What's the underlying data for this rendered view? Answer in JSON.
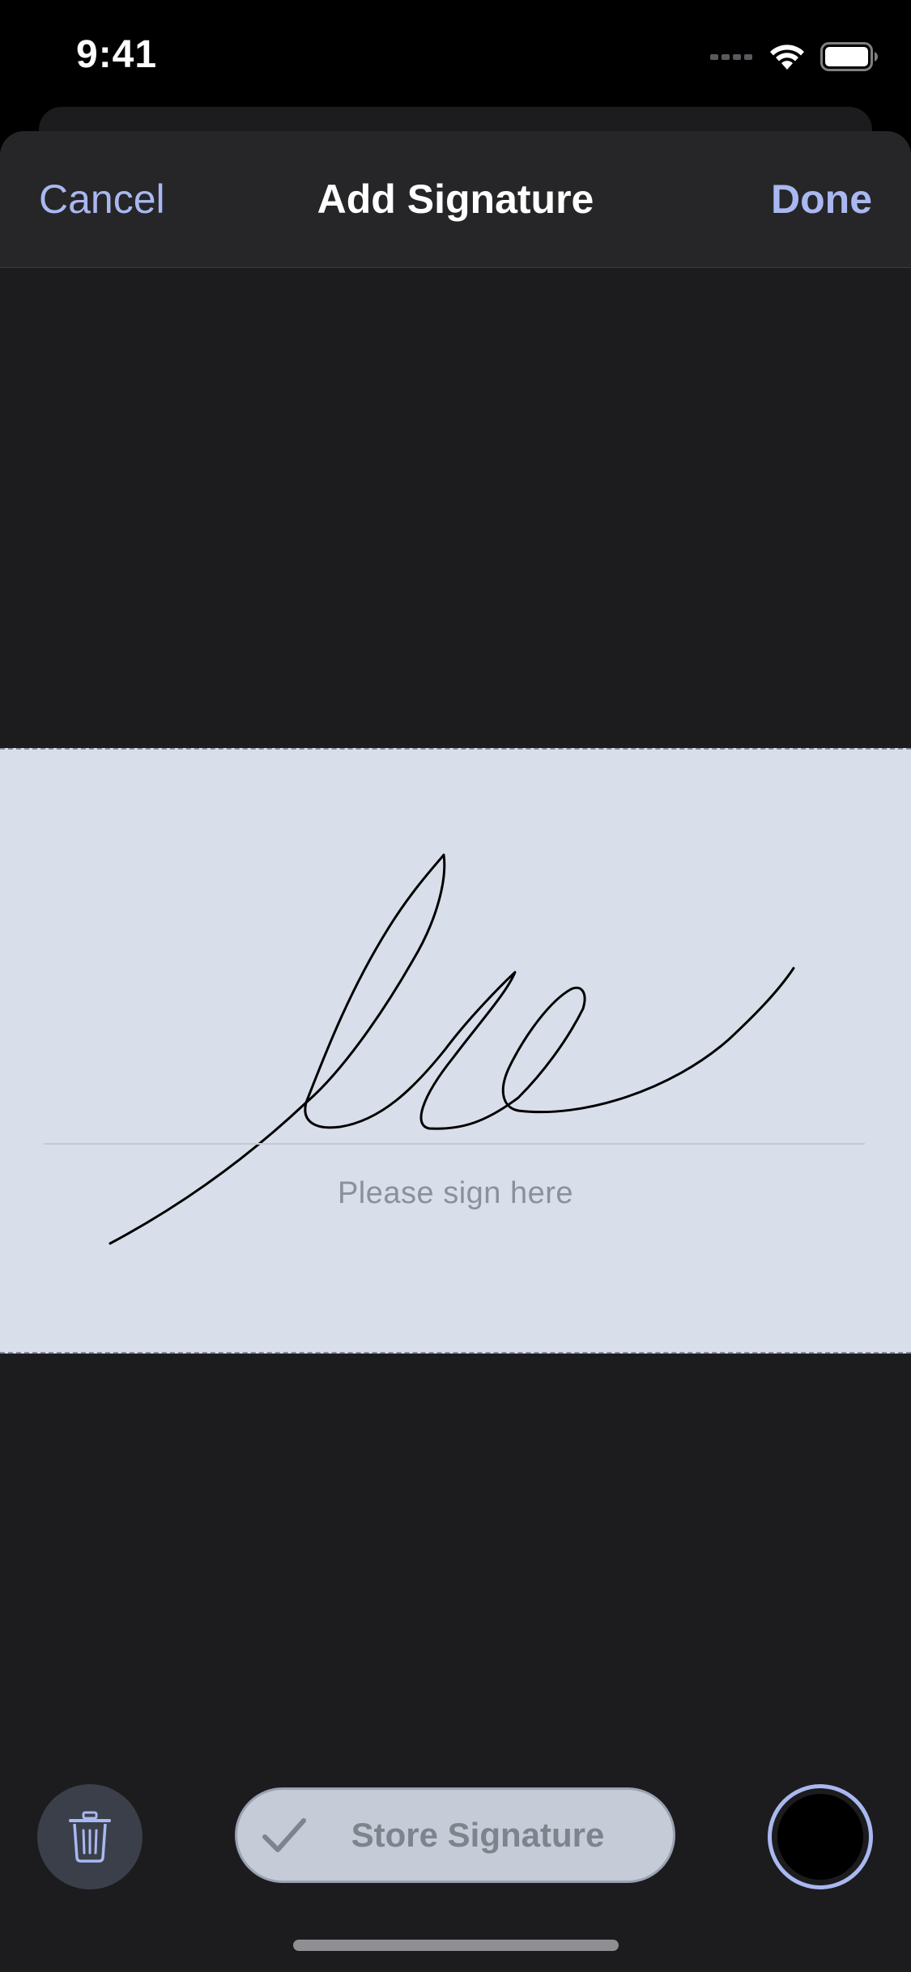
{
  "status_bar": {
    "time": "9:41",
    "signal_icon": "signal-dots-icon",
    "wifi_icon": "wifi-icon",
    "battery_icon": "battery-icon"
  },
  "nav": {
    "cancel_label": "Cancel",
    "title": "Add Signature",
    "done_label": "Done"
  },
  "signature_pad": {
    "hint": "Please sign here",
    "pad_color": "#d9dfea",
    "stroke_color": "#000000"
  },
  "toolbar": {
    "trash_icon": "trash-icon",
    "store_icon": "checkmark-icon",
    "store_label": "Store Signature",
    "selected_ink_color": "#000000",
    "accent_color": "#a9b8f0"
  }
}
